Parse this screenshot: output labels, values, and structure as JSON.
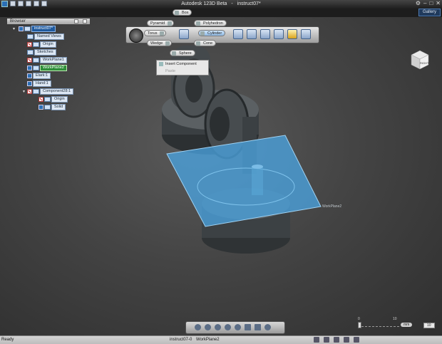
{
  "window": {
    "app_title": "Autodesk 123D Beta",
    "doc_title": "instruct07*",
    "sep": "-"
  },
  "gallery_label": "Gallery",
  "browser": {
    "title": "Browser",
    "items": [
      {
        "label": "instruct07*",
        "icon": "document-icon"
      },
      {
        "label": "Named Views",
        "icon": "folder-icon"
      },
      {
        "label": "Origin",
        "icon": "origin-icon"
      },
      {
        "label": "Sketches",
        "icon": "folder-icon"
      },
      {
        "label": "WorkPlane1",
        "icon": "workplane-icon"
      },
      {
        "label": "WorkPlane2",
        "icon": "workplane-icon"
      },
      {
        "label": "Elark:1",
        "icon": "component-icon"
      },
      {
        "label": "Hand:1",
        "icon": "component-icon"
      },
      {
        "label": "Component28:1",
        "icon": "component-icon"
      },
      {
        "label": "Origin",
        "icon": "origin-icon"
      },
      {
        "label": "Solid",
        "icon": "solid-icon"
      }
    ]
  },
  "primitives": {
    "box": "Box",
    "pyramid": "Pyramid",
    "polyhedron": "Polyhedron",
    "torus": "Torus",
    "cylinder": "Cylinder",
    "wedge": "Wedge",
    "cone": "Cone",
    "sphere": "Sphere"
  },
  "context_menu": {
    "insert_component": "Insert Component",
    "paste": "Paste"
  },
  "viewcube_label": "RIGHT",
  "workplane_label": "WorkPlane2",
  "zoom": {
    "min": "0",
    "max": "10",
    "unit": "mm",
    "value": "10",
    "step": "1"
  },
  "status": {
    "ready": "Ready",
    "doc": "instruct07-0",
    "selection": "WorkPlane2"
  },
  "colors": {
    "workplane": "#4aa3df",
    "selected": "#2f8f3a",
    "accent": "#2b6fb5"
  }
}
